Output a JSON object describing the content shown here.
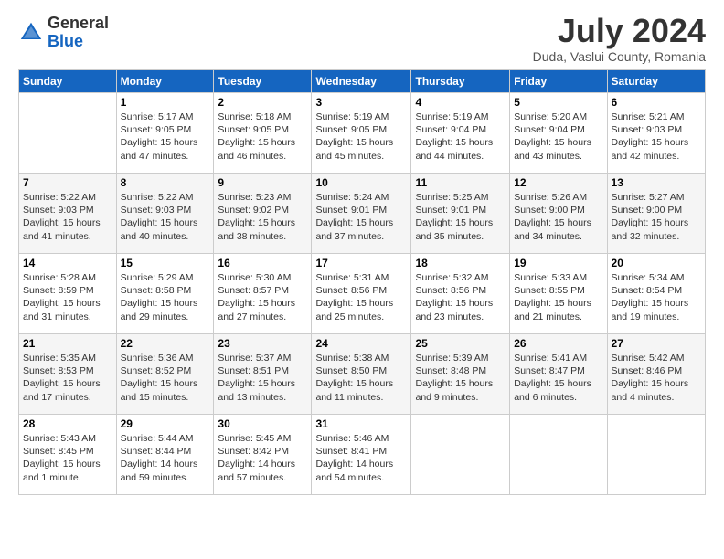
{
  "logo": {
    "general": "General",
    "blue": "Blue"
  },
  "header": {
    "month": "July 2024",
    "location": "Duda, Vaslui County, Romania"
  },
  "weekdays": [
    "Sunday",
    "Monday",
    "Tuesday",
    "Wednesday",
    "Thursday",
    "Friday",
    "Saturday"
  ],
  "weeks": [
    [
      {
        "day": "",
        "text": ""
      },
      {
        "day": "1",
        "text": "Sunrise: 5:17 AM\nSunset: 9:05 PM\nDaylight: 15 hours\nand 47 minutes."
      },
      {
        "day": "2",
        "text": "Sunrise: 5:18 AM\nSunset: 9:05 PM\nDaylight: 15 hours\nand 46 minutes."
      },
      {
        "day": "3",
        "text": "Sunrise: 5:19 AM\nSunset: 9:05 PM\nDaylight: 15 hours\nand 45 minutes."
      },
      {
        "day": "4",
        "text": "Sunrise: 5:19 AM\nSunset: 9:04 PM\nDaylight: 15 hours\nand 44 minutes."
      },
      {
        "day": "5",
        "text": "Sunrise: 5:20 AM\nSunset: 9:04 PM\nDaylight: 15 hours\nand 43 minutes."
      },
      {
        "day": "6",
        "text": "Sunrise: 5:21 AM\nSunset: 9:03 PM\nDaylight: 15 hours\nand 42 minutes."
      }
    ],
    [
      {
        "day": "7",
        "text": "Sunrise: 5:22 AM\nSunset: 9:03 PM\nDaylight: 15 hours\nand 41 minutes."
      },
      {
        "day": "8",
        "text": "Sunrise: 5:22 AM\nSunset: 9:03 PM\nDaylight: 15 hours\nand 40 minutes."
      },
      {
        "day": "9",
        "text": "Sunrise: 5:23 AM\nSunset: 9:02 PM\nDaylight: 15 hours\nand 38 minutes."
      },
      {
        "day": "10",
        "text": "Sunrise: 5:24 AM\nSunset: 9:01 PM\nDaylight: 15 hours\nand 37 minutes."
      },
      {
        "day": "11",
        "text": "Sunrise: 5:25 AM\nSunset: 9:01 PM\nDaylight: 15 hours\nand 35 minutes."
      },
      {
        "day": "12",
        "text": "Sunrise: 5:26 AM\nSunset: 9:00 PM\nDaylight: 15 hours\nand 34 minutes."
      },
      {
        "day": "13",
        "text": "Sunrise: 5:27 AM\nSunset: 9:00 PM\nDaylight: 15 hours\nand 32 minutes."
      }
    ],
    [
      {
        "day": "14",
        "text": "Sunrise: 5:28 AM\nSunset: 8:59 PM\nDaylight: 15 hours\nand 31 minutes."
      },
      {
        "day": "15",
        "text": "Sunrise: 5:29 AM\nSunset: 8:58 PM\nDaylight: 15 hours\nand 29 minutes."
      },
      {
        "day": "16",
        "text": "Sunrise: 5:30 AM\nSunset: 8:57 PM\nDaylight: 15 hours\nand 27 minutes."
      },
      {
        "day": "17",
        "text": "Sunrise: 5:31 AM\nSunset: 8:56 PM\nDaylight: 15 hours\nand 25 minutes."
      },
      {
        "day": "18",
        "text": "Sunrise: 5:32 AM\nSunset: 8:56 PM\nDaylight: 15 hours\nand 23 minutes."
      },
      {
        "day": "19",
        "text": "Sunrise: 5:33 AM\nSunset: 8:55 PM\nDaylight: 15 hours\nand 21 minutes."
      },
      {
        "day": "20",
        "text": "Sunrise: 5:34 AM\nSunset: 8:54 PM\nDaylight: 15 hours\nand 19 minutes."
      }
    ],
    [
      {
        "day": "21",
        "text": "Sunrise: 5:35 AM\nSunset: 8:53 PM\nDaylight: 15 hours\nand 17 minutes."
      },
      {
        "day": "22",
        "text": "Sunrise: 5:36 AM\nSunset: 8:52 PM\nDaylight: 15 hours\nand 15 minutes."
      },
      {
        "day": "23",
        "text": "Sunrise: 5:37 AM\nSunset: 8:51 PM\nDaylight: 15 hours\nand 13 minutes."
      },
      {
        "day": "24",
        "text": "Sunrise: 5:38 AM\nSunset: 8:50 PM\nDaylight: 15 hours\nand 11 minutes."
      },
      {
        "day": "25",
        "text": "Sunrise: 5:39 AM\nSunset: 8:48 PM\nDaylight: 15 hours\nand 9 minutes."
      },
      {
        "day": "26",
        "text": "Sunrise: 5:41 AM\nSunset: 8:47 PM\nDaylight: 15 hours\nand 6 minutes."
      },
      {
        "day": "27",
        "text": "Sunrise: 5:42 AM\nSunset: 8:46 PM\nDaylight: 15 hours\nand 4 minutes."
      }
    ],
    [
      {
        "day": "28",
        "text": "Sunrise: 5:43 AM\nSunset: 8:45 PM\nDaylight: 15 hours\nand 1 minute."
      },
      {
        "day": "29",
        "text": "Sunrise: 5:44 AM\nSunset: 8:44 PM\nDaylight: 14 hours\nand 59 minutes."
      },
      {
        "day": "30",
        "text": "Sunrise: 5:45 AM\nSunset: 8:42 PM\nDaylight: 14 hours\nand 57 minutes."
      },
      {
        "day": "31",
        "text": "Sunrise: 5:46 AM\nSunset: 8:41 PM\nDaylight: 14 hours\nand 54 minutes."
      },
      {
        "day": "",
        "text": ""
      },
      {
        "day": "",
        "text": ""
      },
      {
        "day": "",
        "text": ""
      }
    ]
  ]
}
